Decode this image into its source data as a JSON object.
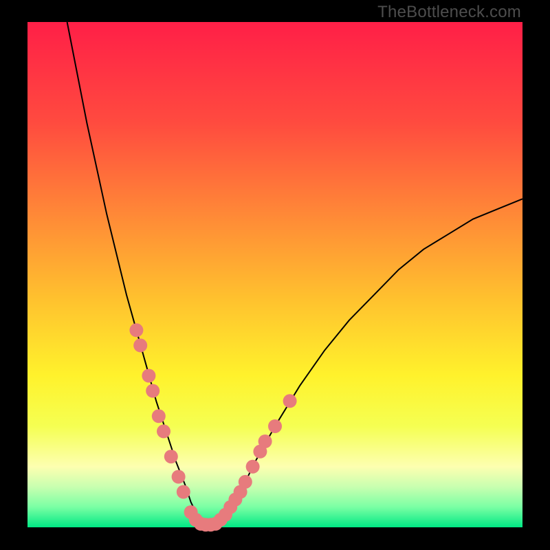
{
  "watermark": "TheBottleneck.com",
  "chart_data": {
    "type": "line",
    "title": "",
    "xlabel": "",
    "ylabel": "",
    "xlim": [
      0,
      100
    ],
    "ylim": [
      0,
      100
    ],
    "background": "vertical-gradient",
    "gradient_stops": [
      {
        "pos": 0.0,
        "color": "#ff1f47"
      },
      {
        "pos": 0.2,
        "color": "#ff4b3f"
      },
      {
        "pos": 0.4,
        "color": "#ff8f36"
      },
      {
        "pos": 0.55,
        "color": "#ffc22e"
      },
      {
        "pos": 0.7,
        "color": "#fff22c"
      },
      {
        "pos": 0.8,
        "color": "#f5ff52"
      },
      {
        "pos": 0.88,
        "color": "#fdffb0"
      },
      {
        "pos": 0.92,
        "color": "#c8ffb0"
      },
      {
        "pos": 0.96,
        "color": "#7affa4"
      },
      {
        "pos": 1.0,
        "color": "#00e884"
      }
    ],
    "series": [
      {
        "name": "bottleneck-curve",
        "stroke": "#000000",
        "stroke_width": 2,
        "x": [
          8,
          10,
          12,
          14,
          16,
          18,
          20,
          22,
          24,
          26,
          28,
          30,
          32,
          33,
          34,
          35,
          36,
          38,
          40,
          42,
          44,
          46,
          50,
          55,
          60,
          65,
          70,
          75,
          80,
          85,
          90,
          95,
          100
        ],
        "y": [
          100,
          90,
          80,
          71,
          62,
          54,
          46,
          39,
          32,
          25,
          19,
          13,
          8,
          5,
          3,
          1,
          0,
          0,
          2,
          5,
          9,
          13,
          20,
          28,
          35,
          41,
          46,
          51,
          55,
          58,
          61,
          63,
          65
        ]
      }
    ],
    "markers": {
      "name": "data-beads",
      "color": "#e77b7d",
      "radius": 10,
      "points": [
        {
          "x": 22.0,
          "y": 39
        },
        {
          "x": 22.8,
          "y": 36
        },
        {
          "x": 24.5,
          "y": 30
        },
        {
          "x": 25.3,
          "y": 27
        },
        {
          "x": 26.5,
          "y": 22
        },
        {
          "x": 27.5,
          "y": 19
        },
        {
          "x": 29.0,
          "y": 14
        },
        {
          "x": 30.5,
          "y": 10
        },
        {
          "x": 31.5,
          "y": 7
        },
        {
          "x": 33.0,
          "y": 3
        },
        {
          "x": 34.0,
          "y": 1.5
        },
        {
          "x": 35.0,
          "y": 0.7
        },
        {
          "x": 36.0,
          "y": 0.5
        },
        {
          "x": 37.0,
          "y": 0.5
        },
        {
          "x": 38.0,
          "y": 0.7
        },
        {
          "x": 39.0,
          "y": 1.5
        },
        {
          "x": 40.0,
          "y": 2.5
        },
        {
          "x": 41.0,
          "y": 4
        },
        {
          "x": 42.0,
          "y": 5.5
        },
        {
          "x": 43.0,
          "y": 7
        },
        {
          "x": 44.0,
          "y": 9
        },
        {
          "x": 45.5,
          "y": 12
        },
        {
          "x": 47.0,
          "y": 15
        },
        {
          "x": 48.0,
          "y": 17
        },
        {
          "x": 50.0,
          "y": 20
        },
        {
          "x": 53.0,
          "y": 25
        }
      ]
    }
  }
}
